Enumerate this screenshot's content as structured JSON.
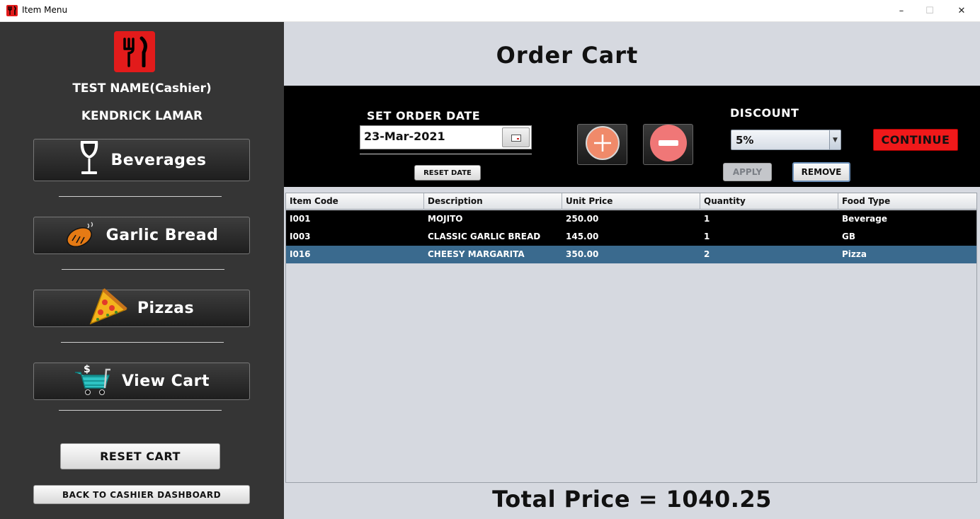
{
  "window": {
    "title": "Item Menu",
    "min_icon": "–",
    "max_icon": "☐",
    "close_icon": "✕"
  },
  "sidebar": {
    "user_name": "TEST NAME(Cashier)",
    "cashier_name": "KENDRICK LAMAR",
    "menu": [
      {
        "label": "Beverages",
        "icon": "wine-glass-icon"
      },
      {
        "label": "Garlic Bread",
        "icon": "bread-icon"
      },
      {
        "label": "Pizzas",
        "icon": "pizza-slice-icon"
      },
      {
        "label": "View Cart",
        "icon": "shopping-cart-icon"
      }
    ],
    "reset_cart": "RESET CART",
    "back": "BACK TO CASHIER DASHBOARD"
  },
  "main": {
    "title": "Order Cart",
    "order_date_label": "SET ORDER DATE",
    "order_date": "23-Mar-2021",
    "reset_date": "RESET DATE",
    "discount_label": "DISCOUNT",
    "discount_value": "5%",
    "apply": "APPLY",
    "remove": "REMOVE",
    "continue": "CONTINUE",
    "total": "Total Price = 1040.25"
  },
  "table": {
    "columns": [
      "Item Code",
      "Description",
      "Unit Price",
      "Quantity",
      "Food Type"
    ],
    "rows": [
      [
        "I001",
        "MOJITO",
        "250.00",
        "1",
        "Beverage"
      ],
      [
        "I003",
        "CLASSIC GARLIC BREAD",
        "145.00",
        "1",
        "GB"
      ],
      [
        "I016",
        "CHEESY MARGARITA",
        "350.00",
        "2",
        "Pizza"
      ]
    ]
  },
  "colors": {
    "sidebar_bg": "#353535",
    "accent_red": "#e21b1b",
    "selected_row": "#3a6a8e",
    "main_bg": "#d6d9e0"
  }
}
